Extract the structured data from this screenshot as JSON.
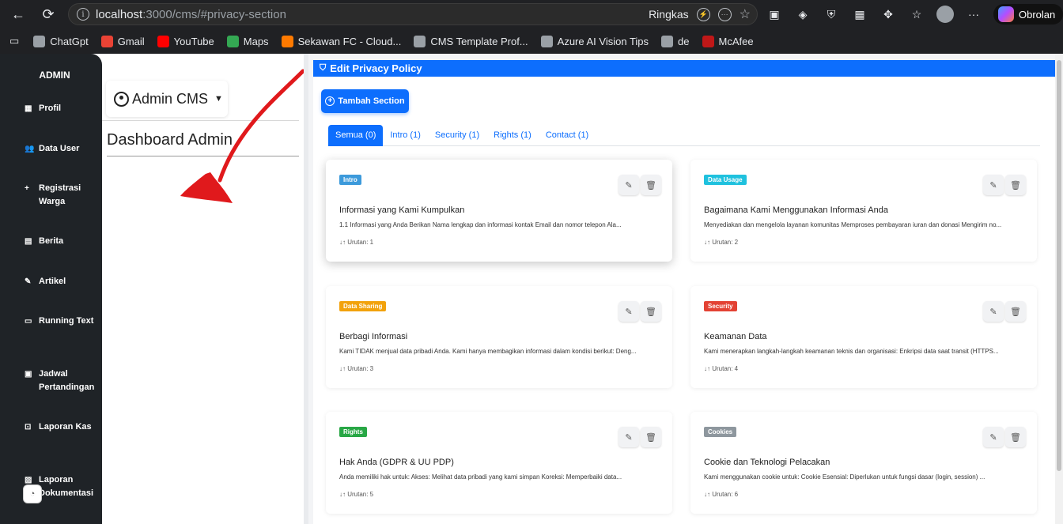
{
  "browser": {
    "url_host": "localhost",
    "url_rest": ":3000/cms/#privacy-section",
    "reader_label": "Ringkas",
    "chat_label": "Obrolan"
  },
  "bookmarks": [
    {
      "label": "ChatGpt",
      "color": "#9aa0a6"
    },
    {
      "label": "Gmail",
      "color": "#ea4335"
    },
    {
      "label": "YouTube",
      "color": "#ff0000"
    },
    {
      "label": "Maps",
      "color": "#34a853"
    },
    {
      "label": "Sekawan FC - Cloud...",
      "color": "#ff7a00"
    },
    {
      "label": "CMS Template Prof...",
      "color": "#9aa0a6"
    },
    {
      "label": "Azure AI Vision Tips",
      "color": "#9aa0a6"
    },
    {
      "label": "de",
      "color": "#9aa0a6"
    },
    {
      "label": "McAfee",
      "color": "#c01818"
    }
  ],
  "sidebar": {
    "brand": "ADMIN",
    "items": [
      {
        "label": "Profil",
        "icon": "▦"
      },
      {
        "label": "Data User",
        "icon": "👥"
      },
      {
        "label": "Registrasi Warga",
        "icon": "+"
      },
      {
        "label": "Berita",
        "icon": "▤"
      },
      {
        "label": "Artikel",
        "icon": "✎"
      },
      {
        "label": "Running Text",
        "icon": "▭"
      },
      {
        "label": "Jadwal Pertandingan",
        "icon": "▣"
      },
      {
        "label": "Laporan Kas",
        "icon": "⊡"
      },
      {
        "label": "Laporan Dokumentasi",
        "icon": "▨"
      }
    ]
  },
  "middle": {
    "user_menu": "Admin CMS",
    "title": "Dashboard Admin"
  },
  "content": {
    "header": "Edit Privacy Policy",
    "add_button": "Tambah Section",
    "tabs": [
      "Semua (0)",
      "Intro (1)",
      "Security (1)",
      "Rights (1)",
      "Contact (1)"
    ],
    "cards": [
      {
        "badge": "Intro",
        "badge_color": "#3c9adb",
        "title": "Informasi yang Kami Kumpulkan",
        "desc": "1.1 Informasi yang Anda Berikan Nama lengkap dan informasi kontak Email dan nomor telepon Ala...",
        "order": "↓↑ Urutan: 1"
      },
      {
        "badge": "Data Usage",
        "badge_color": "#1fc1de",
        "title": "Bagaimana Kami Menggunakan Informasi Anda",
        "desc": "Menyediakan dan mengelola layanan komunitas Memproses pembayaran iuran dan donasi Mengirim no...",
        "order": "↓↑ Urutan: 2"
      },
      {
        "badge": "Data Sharing",
        "badge_color": "#f2a20c",
        "title": "Berbagi Informasi",
        "desc": "Kami TIDAK menjual data pribadi Anda. Kami hanya membagikan informasi dalam kondisi berikut: Deng...",
        "order": "↓↑ Urutan: 3"
      },
      {
        "badge": "Security",
        "badge_color": "#e34234",
        "title": "Keamanan Data",
        "desc": "Kami menerapkan langkah-langkah keamanan teknis dan organisasi: Enkripsi data saat transit (HTTPS...",
        "order": "↓↑ Urutan: 4"
      },
      {
        "badge": "Rights",
        "badge_color": "#28a745",
        "title": "Hak Anda (GDPR & UU PDP)",
        "desc": "Anda memiliki hak untuk: Akses: Melihat data pribadi yang kami simpan Koreksi: Memperbaiki data...",
        "order": "↓↑ Urutan: 5"
      },
      {
        "badge": "Cookies",
        "badge_color": "#8e979e",
        "title": "Cookie dan Teknologi Pelacakan",
        "desc": "Kami menggunakan cookie untuk: Cookie Esensial: Diperlukan untuk fungsi dasar (login, session) ...",
        "order": "↓↑ Urutan: 6"
      }
    ]
  },
  "colors": {
    "primary": "#0d6efd",
    "sidebar": "#1f2327",
    "annotation": "#e0191c"
  }
}
